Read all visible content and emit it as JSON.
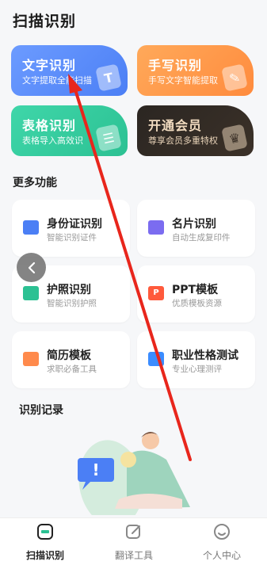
{
  "header": {
    "title": "扫描识别"
  },
  "feature_cards": [
    {
      "title": "文字识别",
      "subtitle": "文字提取全能扫描",
      "icon": "text-doc-icon",
      "glyph": "T"
    },
    {
      "title": "手写识别",
      "subtitle": "手写文字智能提取",
      "icon": "pen-doc-icon",
      "glyph": "✎"
    },
    {
      "title": "表格识别",
      "subtitle": "表格导入高效识",
      "icon": "table-doc-icon",
      "glyph": "☰"
    },
    {
      "title": "开通会员",
      "subtitle": "尊享会员多重特权",
      "icon": "crown-icon",
      "glyph": "♛"
    }
  ],
  "more": {
    "title": "更多功能",
    "tools": [
      {
        "title": "身份证识别",
        "subtitle": "智能识别证件",
        "icon": "id-card-icon"
      },
      {
        "title": "名片识别",
        "subtitle": "自动生成复印件",
        "icon": "business-card-icon"
      },
      {
        "title": "护照识别",
        "subtitle": "智能识别护照",
        "icon": "passport-icon"
      },
      {
        "title": "PPT模板",
        "subtitle": "优质模板资源",
        "icon": "ppt-icon",
        "glyph": "P"
      },
      {
        "title": "简历模板",
        "subtitle": "求职必备工具",
        "icon": "resume-icon"
      },
      {
        "title": "职业性格测试",
        "subtitle": "专业心理测评",
        "icon": "personality-test-icon"
      }
    ]
  },
  "records": {
    "title": "识别记录"
  },
  "tabbar": [
    {
      "label": "扫描识别",
      "icon": "scan-icon",
      "active": true
    },
    {
      "label": "翻译工具",
      "icon": "edit-icon",
      "active": false
    },
    {
      "label": "个人中心",
      "icon": "smile-icon",
      "active": false
    }
  ],
  "colors": {
    "card_blue": "#4b7ff5",
    "card_orange": "#ff8b3d",
    "card_green": "#2cc193",
    "card_dark": "#2b2622",
    "annotation_arrow": "#e8261c"
  }
}
